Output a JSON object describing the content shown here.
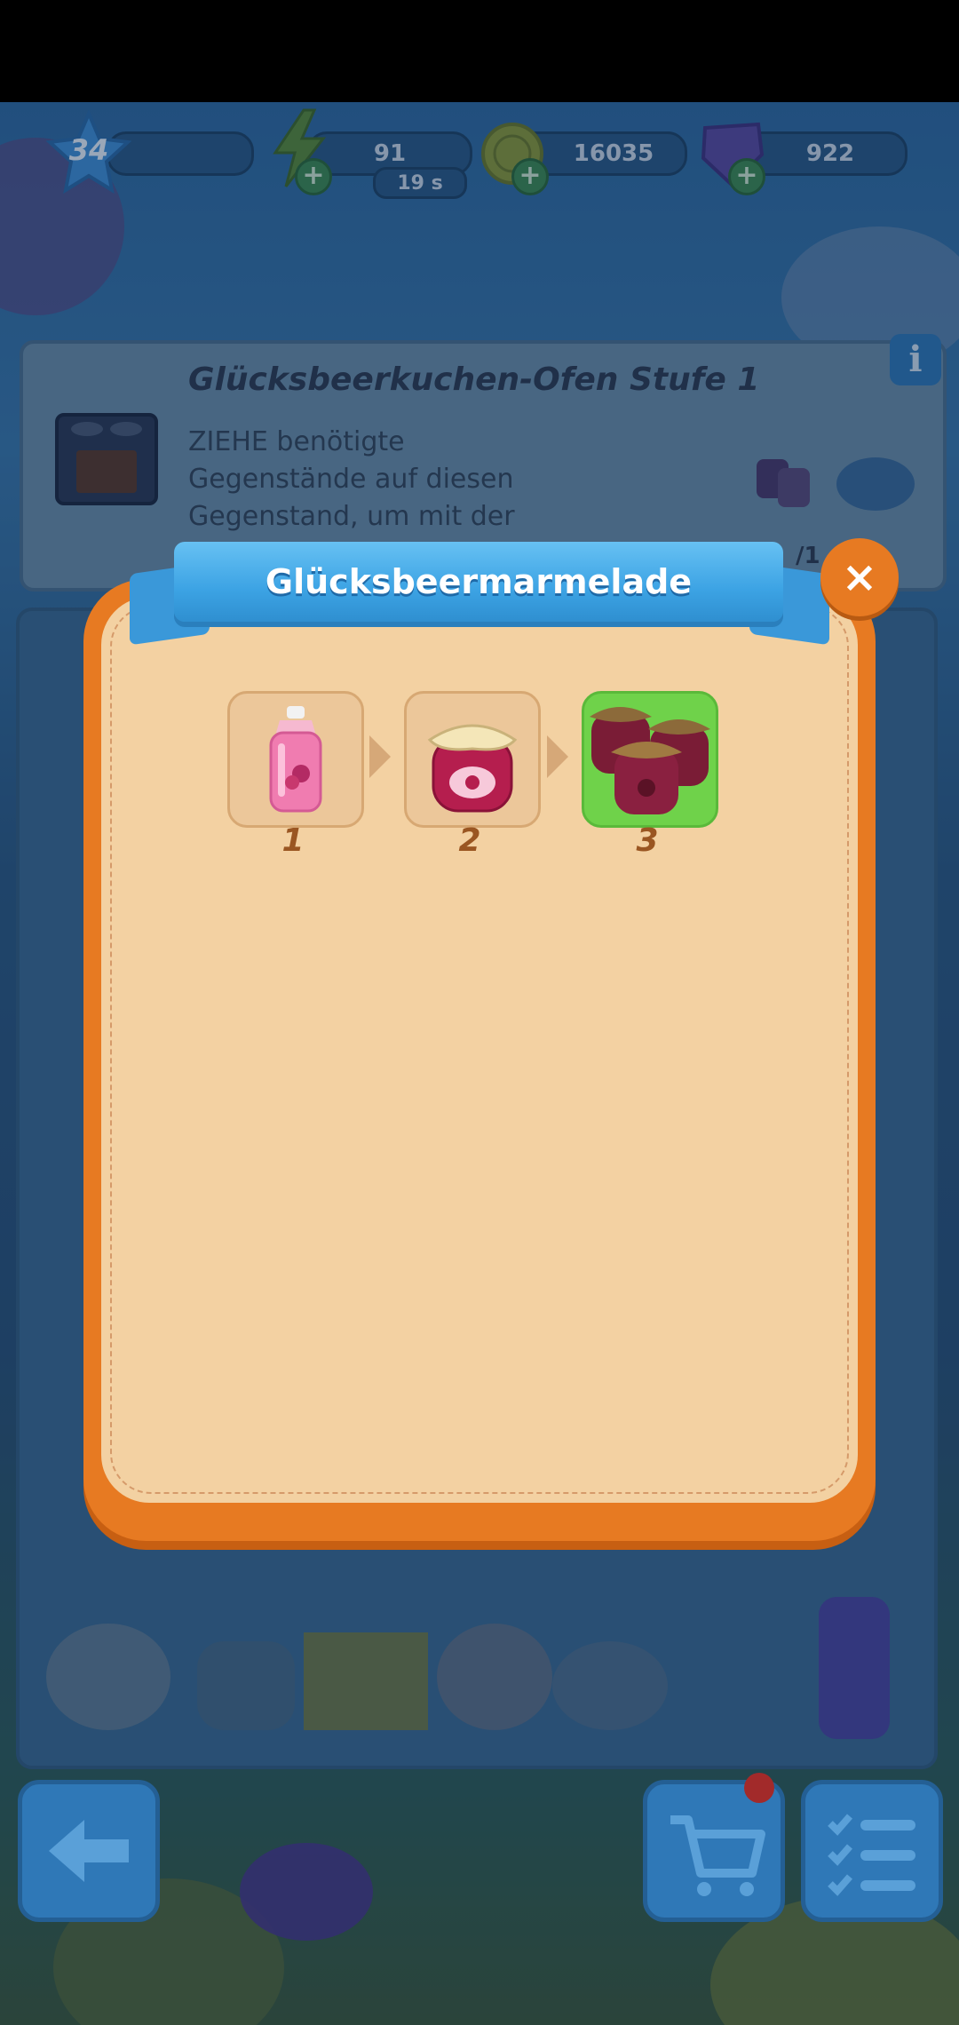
{
  "hud": {
    "level": "34",
    "energy": "91",
    "energy_timer": "19 s",
    "coins": "16035",
    "gems": "922",
    "plus_glyph": "+"
  },
  "info_card": {
    "title": "Glücksbeerkuchen-Ofen Stufe 1",
    "desc_line1": "ZIEHE benötigte",
    "desc_line2": "Gegenstände auf diesen",
    "desc_line3": "Gegenstand, um mit der",
    "count": "/1",
    "info_glyph": "i"
  },
  "modal": {
    "title": "Glücksbeermarmelade",
    "close_glyph": "×",
    "steps": [
      {
        "label": "1",
        "icon": "jam-bottle-icon"
      },
      {
        "label": "2",
        "icon": "jam-jar-icon"
      },
      {
        "label": "3",
        "icon": "jam-jars-stack-icon"
      }
    ]
  },
  "colors": {
    "modal_orange": "#e77a22",
    "modal_cream": "#f3d1a2",
    "ribbon_blue": "#3ca3e4",
    "active_tile": "#6fd24a",
    "step_number": "#9a5622"
  }
}
